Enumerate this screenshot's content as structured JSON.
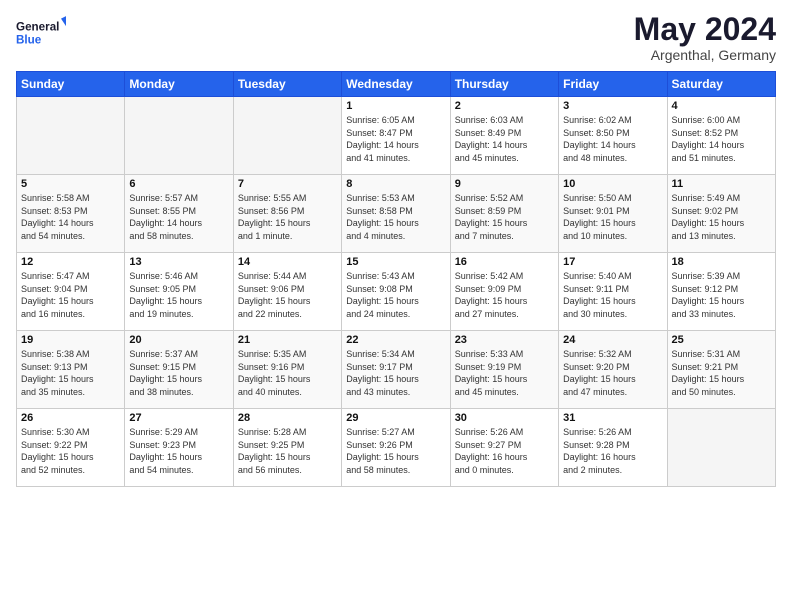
{
  "header": {
    "logo_line1": "General",
    "logo_line2": "Blue",
    "month": "May 2024",
    "location": "Argenthal, Germany"
  },
  "days_of_week": [
    "Sunday",
    "Monday",
    "Tuesday",
    "Wednesday",
    "Thursday",
    "Friday",
    "Saturday"
  ],
  "weeks": [
    [
      {
        "num": "",
        "info": ""
      },
      {
        "num": "",
        "info": ""
      },
      {
        "num": "",
        "info": ""
      },
      {
        "num": "1",
        "info": "Sunrise: 6:05 AM\nSunset: 8:47 PM\nDaylight: 14 hours\nand 41 minutes."
      },
      {
        "num": "2",
        "info": "Sunrise: 6:03 AM\nSunset: 8:49 PM\nDaylight: 14 hours\nand 45 minutes."
      },
      {
        "num": "3",
        "info": "Sunrise: 6:02 AM\nSunset: 8:50 PM\nDaylight: 14 hours\nand 48 minutes."
      },
      {
        "num": "4",
        "info": "Sunrise: 6:00 AM\nSunset: 8:52 PM\nDaylight: 14 hours\nand 51 minutes."
      }
    ],
    [
      {
        "num": "5",
        "info": "Sunrise: 5:58 AM\nSunset: 8:53 PM\nDaylight: 14 hours\nand 54 minutes."
      },
      {
        "num": "6",
        "info": "Sunrise: 5:57 AM\nSunset: 8:55 PM\nDaylight: 14 hours\nand 58 minutes."
      },
      {
        "num": "7",
        "info": "Sunrise: 5:55 AM\nSunset: 8:56 PM\nDaylight: 15 hours\nand 1 minute."
      },
      {
        "num": "8",
        "info": "Sunrise: 5:53 AM\nSunset: 8:58 PM\nDaylight: 15 hours\nand 4 minutes."
      },
      {
        "num": "9",
        "info": "Sunrise: 5:52 AM\nSunset: 8:59 PM\nDaylight: 15 hours\nand 7 minutes."
      },
      {
        "num": "10",
        "info": "Sunrise: 5:50 AM\nSunset: 9:01 PM\nDaylight: 15 hours\nand 10 minutes."
      },
      {
        "num": "11",
        "info": "Sunrise: 5:49 AM\nSunset: 9:02 PM\nDaylight: 15 hours\nand 13 minutes."
      }
    ],
    [
      {
        "num": "12",
        "info": "Sunrise: 5:47 AM\nSunset: 9:04 PM\nDaylight: 15 hours\nand 16 minutes."
      },
      {
        "num": "13",
        "info": "Sunrise: 5:46 AM\nSunset: 9:05 PM\nDaylight: 15 hours\nand 19 minutes."
      },
      {
        "num": "14",
        "info": "Sunrise: 5:44 AM\nSunset: 9:06 PM\nDaylight: 15 hours\nand 22 minutes."
      },
      {
        "num": "15",
        "info": "Sunrise: 5:43 AM\nSunset: 9:08 PM\nDaylight: 15 hours\nand 24 minutes."
      },
      {
        "num": "16",
        "info": "Sunrise: 5:42 AM\nSunset: 9:09 PM\nDaylight: 15 hours\nand 27 minutes."
      },
      {
        "num": "17",
        "info": "Sunrise: 5:40 AM\nSunset: 9:11 PM\nDaylight: 15 hours\nand 30 minutes."
      },
      {
        "num": "18",
        "info": "Sunrise: 5:39 AM\nSunset: 9:12 PM\nDaylight: 15 hours\nand 33 minutes."
      }
    ],
    [
      {
        "num": "19",
        "info": "Sunrise: 5:38 AM\nSunset: 9:13 PM\nDaylight: 15 hours\nand 35 minutes."
      },
      {
        "num": "20",
        "info": "Sunrise: 5:37 AM\nSunset: 9:15 PM\nDaylight: 15 hours\nand 38 minutes."
      },
      {
        "num": "21",
        "info": "Sunrise: 5:35 AM\nSunset: 9:16 PM\nDaylight: 15 hours\nand 40 minutes."
      },
      {
        "num": "22",
        "info": "Sunrise: 5:34 AM\nSunset: 9:17 PM\nDaylight: 15 hours\nand 43 minutes."
      },
      {
        "num": "23",
        "info": "Sunrise: 5:33 AM\nSunset: 9:19 PM\nDaylight: 15 hours\nand 45 minutes."
      },
      {
        "num": "24",
        "info": "Sunrise: 5:32 AM\nSunset: 9:20 PM\nDaylight: 15 hours\nand 47 minutes."
      },
      {
        "num": "25",
        "info": "Sunrise: 5:31 AM\nSunset: 9:21 PM\nDaylight: 15 hours\nand 50 minutes."
      }
    ],
    [
      {
        "num": "26",
        "info": "Sunrise: 5:30 AM\nSunset: 9:22 PM\nDaylight: 15 hours\nand 52 minutes."
      },
      {
        "num": "27",
        "info": "Sunrise: 5:29 AM\nSunset: 9:23 PM\nDaylight: 15 hours\nand 54 minutes."
      },
      {
        "num": "28",
        "info": "Sunrise: 5:28 AM\nSunset: 9:25 PM\nDaylight: 15 hours\nand 56 minutes."
      },
      {
        "num": "29",
        "info": "Sunrise: 5:27 AM\nSunset: 9:26 PM\nDaylight: 15 hours\nand 58 minutes."
      },
      {
        "num": "30",
        "info": "Sunrise: 5:26 AM\nSunset: 9:27 PM\nDaylight: 16 hours\nand 0 minutes."
      },
      {
        "num": "31",
        "info": "Sunrise: 5:26 AM\nSunset: 9:28 PM\nDaylight: 16 hours\nand 2 minutes."
      },
      {
        "num": "",
        "info": ""
      }
    ]
  ]
}
